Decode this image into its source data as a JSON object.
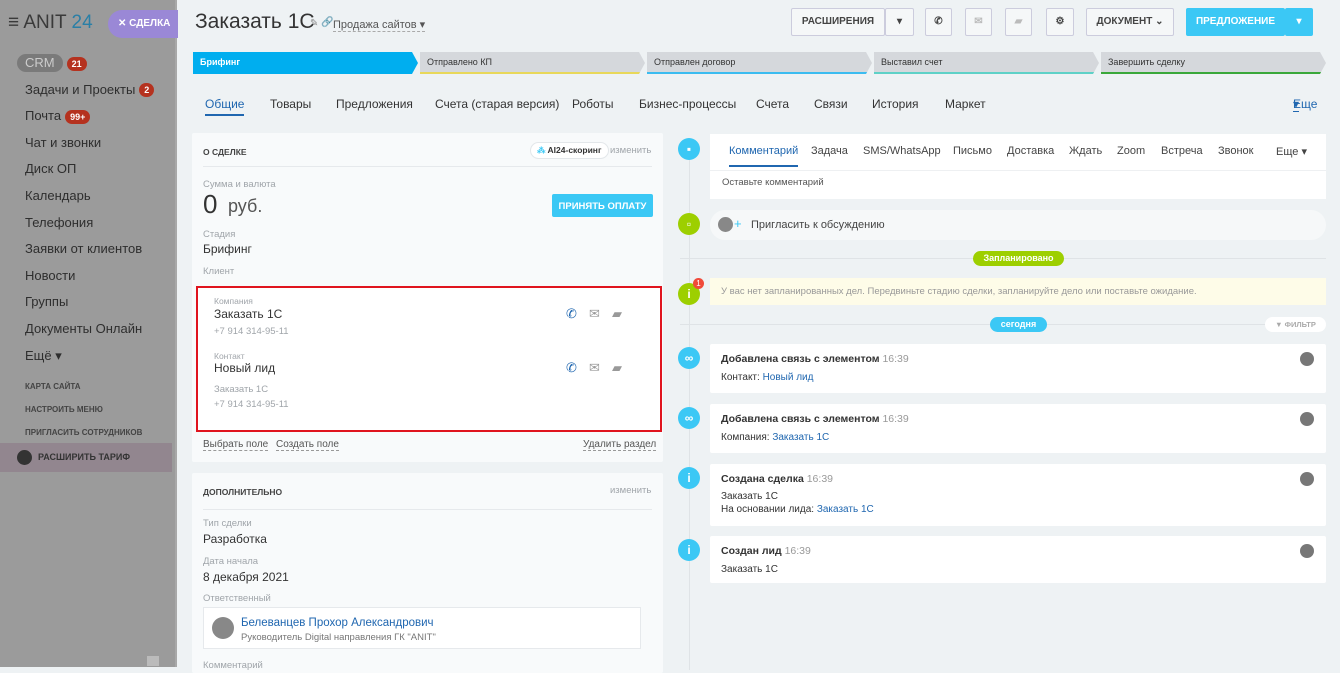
{
  "sidebar": {
    "logo_a": "ANIT",
    "logo_b": "24",
    "deal_tab": "СДЕЛКА",
    "items": [
      {
        "label": "CRM",
        "badge": "21"
      },
      {
        "label": "Задачи и Проекты",
        "badge": "2"
      },
      {
        "label": "Почта",
        "badge": "99+"
      },
      {
        "label": "Чат и звонки"
      },
      {
        "label": "Диск ОП"
      },
      {
        "label": "Календарь"
      },
      {
        "label": "Телефония"
      },
      {
        "label": "Заявки от клиентов"
      },
      {
        "label": "Новости"
      },
      {
        "label": "Группы"
      },
      {
        "label": "Документы Онлайн"
      },
      {
        "label": "Ещё ▾"
      }
    ],
    "sitemap": "КАРТА САЙТА",
    "configure": "НАСТРОИТЬ МЕНЮ",
    "invite": "ПРИГЛАСИТЬ СОТРУДНИКОВ",
    "tariff": "РАСШИРИТЬ ТАРИФ"
  },
  "header": {
    "title": "Заказать 1С",
    "category": "Продажа сайтов",
    "extensions": "РАСШИРЕНИЯ",
    "document": "ДОКУМЕНТ",
    "proposal": "ПРЕДЛОЖЕНИЕ"
  },
  "stages": [
    "Брифинг",
    "Отправлено КП",
    "Отправлен договор",
    "Выставил счет",
    "Завершить сделку"
  ],
  "tabs": [
    "Общие",
    "Товары",
    "Предложения",
    "Счета (старая версия)",
    "Роботы",
    "Бизнес-процессы",
    "Счета",
    "Связи",
    "История",
    "Маркет"
  ],
  "tabs_more": "Еще",
  "deal": {
    "section": "О СДЕЛКЕ",
    "scoring": "AI24-скоринг",
    "edit": "изменить",
    "sum_label": "Сумма и валюта",
    "sum": "0",
    "currency": "руб.",
    "pay": "ПРИНЯТЬ ОПЛАТУ",
    "stage_label": "Стадия",
    "stage": "Брифинг",
    "client_label": "Клиент",
    "company_label": "Компания",
    "company": "Заказать 1С",
    "company_phone": "+7 914 314-95-11",
    "contact_label": "Контакт",
    "contact": "Новый лид",
    "contact_company": "Заказать 1С",
    "contact_phone": "+7 914 314-95-11",
    "select_field": "Выбрать поле",
    "create_field": "Создать поле",
    "delete_section": "Удалить раздел"
  },
  "extra": {
    "section": "ДОПОЛНИТЕЛЬНО",
    "edit": "изменить",
    "type_label": "Тип сделки",
    "type": "Разработка",
    "date_label": "Дата начала",
    "date": "8 декабря 2021",
    "resp_label": "Ответственный",
    "resp_name": "Белеванцев Прохор Александрович",
    "resp_pos": "Руководитель Digital направления ГК \"ANIT\"",
    "comment_label": "Комментарий"
  },
  "activity": {
    "tabs": [
      "Комментарий",
      "Задача",
      "SMS/WhatsApp",
      "Письмо",
      "Доставка",
      "Ждать",
      "Zoom",
      "Встреча",
      "Звонок"
    ],
    "more": "Еще",
    "placeholder": "Оставьте комментарий",
    "invite": "Пригласить к обсуждению",
    "planned": "Запланировано",
    "no_tasks": "У вас нет запланированных дел. Передвиньте стадию сделки, запланируйте дело или поставьте ожидание.",
    "notif": "1",
    "today": "сегодня",
    "filter": "ФИЛЬТР"
  },
  "events": [
    {
      "title": "Добавлена связь с элементом",
      "time": "16:39",
      "l1": "Контакт: ",
      "l1link": "Новый лид"
    },
    {
      "title": "Добавлена связь с элементом",
      "time": "16:39",
      "l1": "Компания: ",
      "l1link": "Заказать 1С"
    },
    {
      "title": "Создана сделка",
      "time": "16:39",
      "l1": "Заказать 1С",
      "l2": "На основании лида: ",
      "l2link": "Заказать 1С"
    },
    {
      "title": "Создан лид",
      "time": "16:39",
      "l1link": "Заказать 1С"
    }
  ]
}
